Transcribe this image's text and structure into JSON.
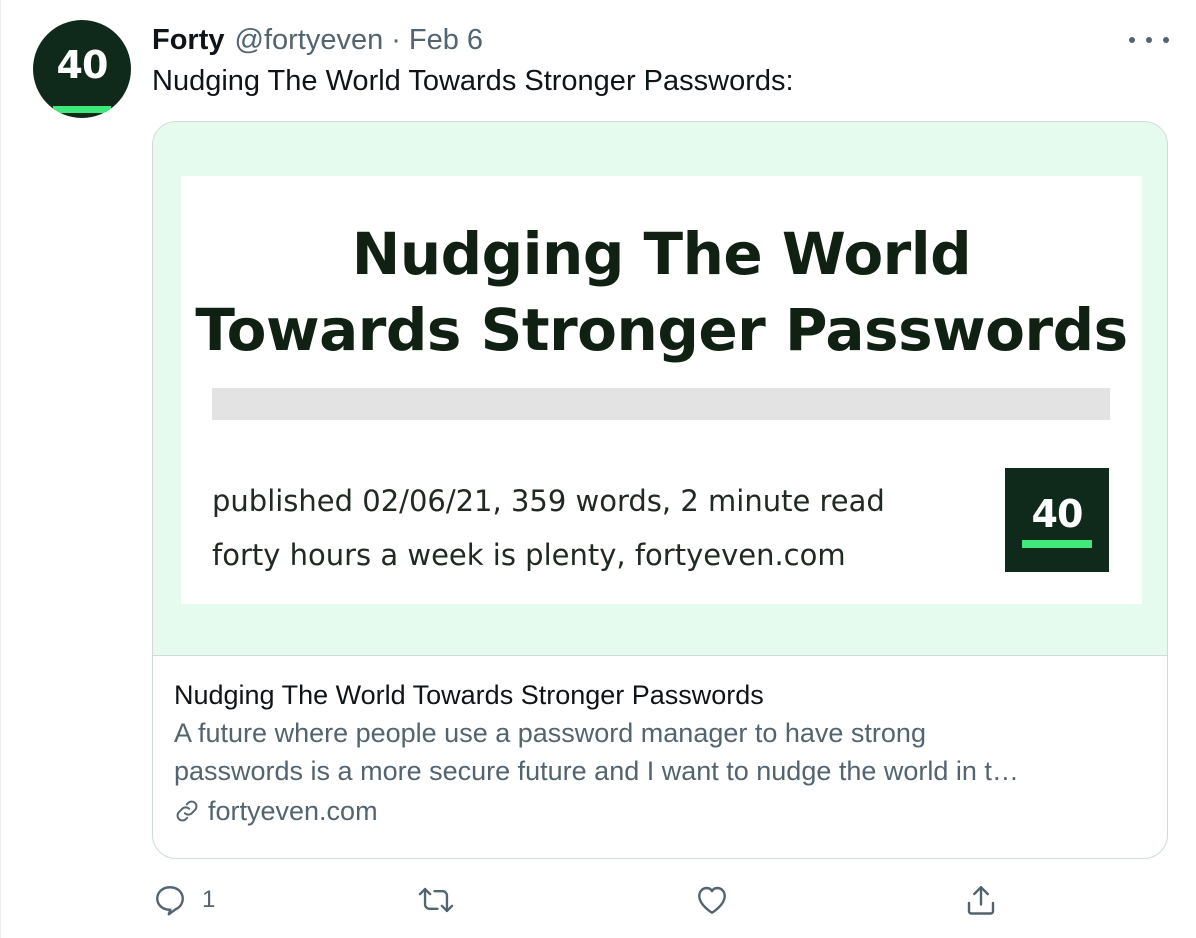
{
  "tweet": {
    "avatar_text": "40",
    "author_name": "Forty",
    "author_handle": "@fortyeven",
    "separator": "·",
    "date": "Feb 6",
    "text": "Nudging The World Towards Stronger Passwords:"
  },
  "card": {
    "image": {
      "title_line1": "Nudging The World",
      "title_line2": "Towards Stronger Passwords",
      "meta_line1": "published 02/06/21, 359 words, 2 minute read",
      "meta_line2": "forty hours a week is plenty, fortyeven.com",
      "logo_text": "40"
    },
    "title": "Nudging The World Towards Stronger Passwords",
    "description_line1": "A future where people use a password manager to have strong",
    "description_line2": "passwords is a more secure future and I want to nudge the world in t…",
    "domain": "fortyeven.com"
  },
  "actions": {
    "reply_count": "1",
    "retweet_count": "",
    "like_count": ""
  },
  "icons": {
    "more": "more-icon",
    "link": "link-icon",
    "reply": "reply-icon",
    "retweet": "retweet-icon",
    "like": "like-icon",
    "share": "share-icon"
  },
  "colors": {
    "brand_dark": "#0f2a1b",
    "brand_green": "#3ee87a",
    "card_image_bg": "#e5fbee",
    "secondary_text": "#536471",
    "primary_text": "#0f1419"
  }
}
